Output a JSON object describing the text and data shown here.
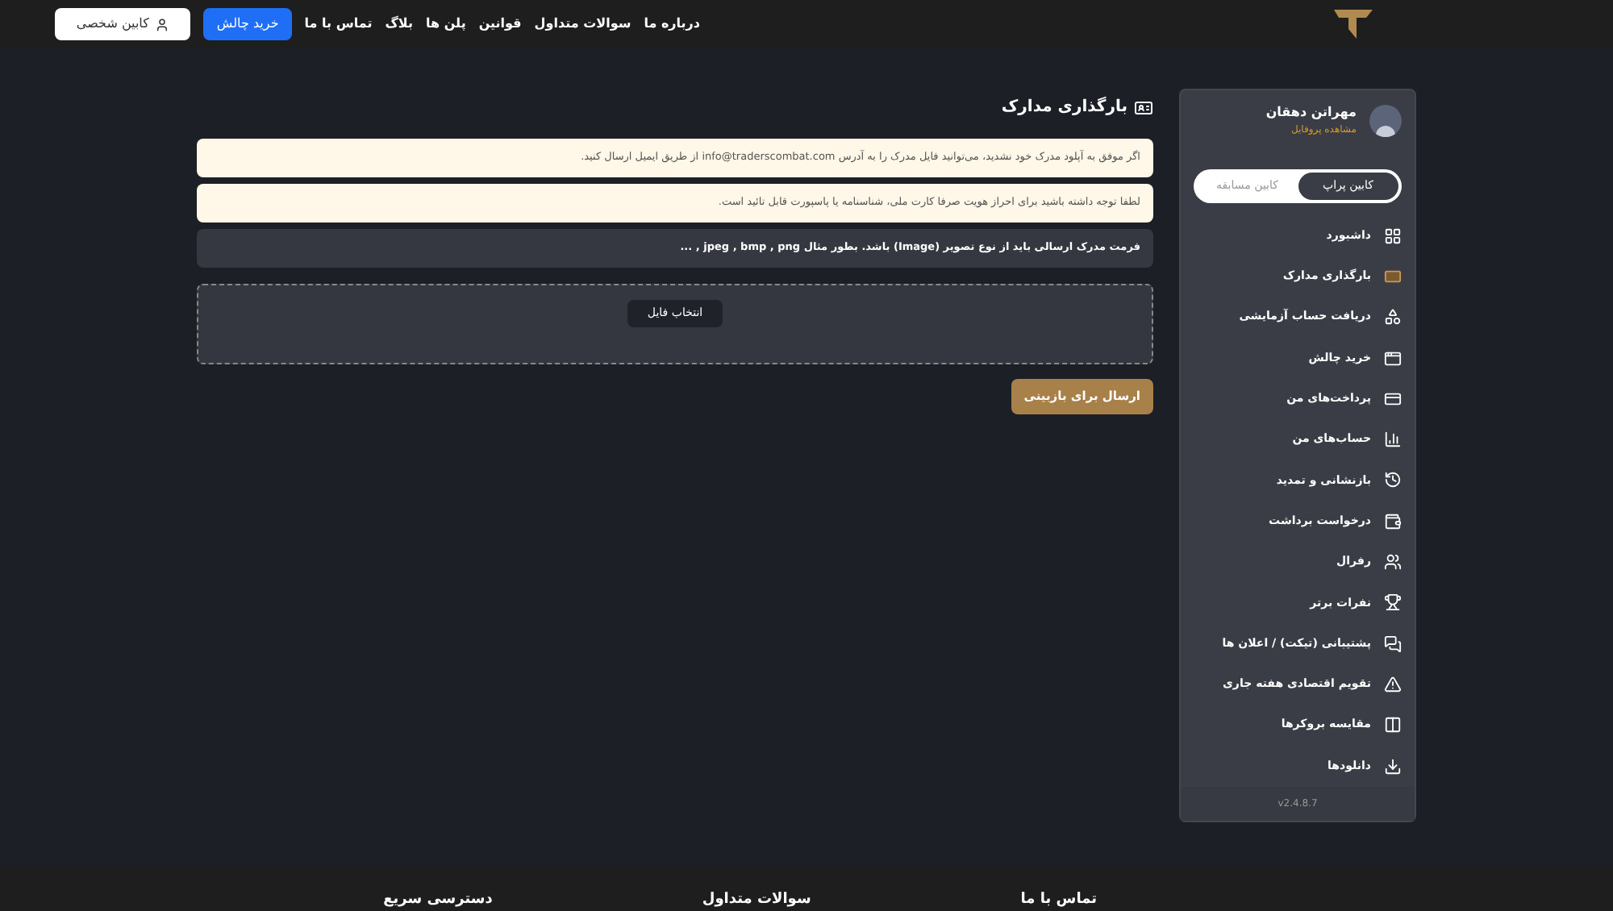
{
  "header": {
    "nav": [
      {
        "label": "درباره ما"
      },
      {
        "label": "سوالات متداول"
      },
      {
        "label": "قوانین"
      },
      {
        "label": "پلن ها"
      },
      {
        "label": "بلاگ"
      },
      {
        "label": "تماس با ما"
      }
    ],
    "buy_button": "خرید چالش",
    "cabin_button": "کابین شخصی"
  },
  "sidebar": {
    "user": {
      "name": "مهراتن دهقان",
      "link": "مشاهده پروفایل"
    },
    "tabs": [
      {
        "label": "کابین پراپ",
        "selected": true
      },
      {
        "label": "کابین مسابقه",
        "selected": false
      }
    ],
    "items": [
      {
        "label": "داشبورد",
        "selected": false
      },
      {
        "label": "بارگذاری مدارک",
        "selected": true
      },
      {
        "label": "دریافت حساب آزمایشی",
        "selected": false
      },
      {
        "label": "خرید چالش",
        "selected": false
      },
      {
        "label": "پرداخت‌های من",
        "selected": false
      },
      {
        "label": "حساب‌های من",
        "selected": false
      },
      {
        "label": "بازنشانی و تمدید",
        "selected": false
      },
      {
        "label": "درخواست برداشت",
        "selected": false
      },
      {
        "label": "رفرال",
        "selected": false
      },
      {
        "label": "نفرات برتر",
        "selected": false
      },
      {
        "label": "پشتیبانی (تیکت) / اعلان ها",
        "selected": false
      },
      {
        "label": "تقویم اقتصادی هفته جاری",
        "selected": false
      },
      {
        "label": "مقایسه بروکرها",
        "selected": false
      },
      {
        "label": "دانلودها",
        "selected": false
      }
    ],
    "version": "v2.4.8.7"
  },
  "main": {
    "title": "بارگذاری مدارک",
    "alerts": [
      {
        "kind": "warning",
        "text": "اگر موفق به آپلود مدرک خود نشدید، می‌توانید فایل مدرک را به آدرس info@traderscombat.com از طریق ایمیل ارسال کنید."
      },
      {
        "kind": "warning",
        "text": "لطفا توجه داشته باشید برای احراز هویت صرفا کارت ملی، شناسنامه یا پاسپورت قابل تائید است."
      },
      {
        "kind": "info",
        "text": "فرمت مدرک ارسالی باید از نوع تصویر (Image) باشد. بطور مثال jpeg , bmp , png , ..."
      }
    ],
    "file_button": "انتخاب فایل",
    "submit_button": "ارسال برای بازبینی"
  },
  "footer": {
    "headings": [
      "تماس با ما",
      "سوالات متداول",
      "دسترسی سریع"
    ]
  }
}
